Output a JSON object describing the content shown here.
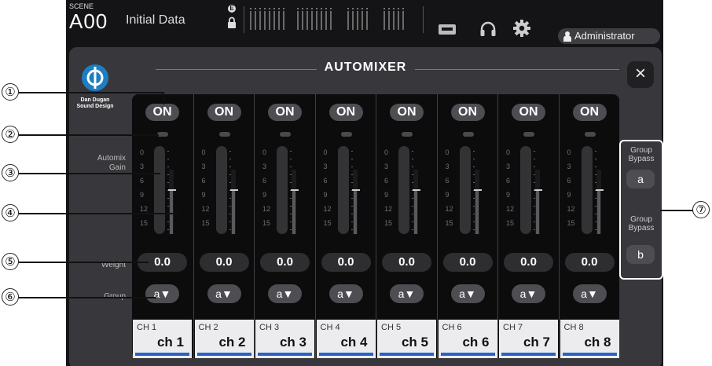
{
  "topbar": {
    "scene_label": "SCENE",
    "scene_number": "A00",
    "scene_name": "Initial Data",
    "e_badge": "E",
    "user": "Administrator"
  },
  "panel": {
    "title": "AUTOMIXER",
    "close": "×",
    "brand_line1": "Dan Dugan",
    "brand_line2": "Sound Design"
  },
  "row_labels": {
    "gain1": "Automix",
    "gain2": "Gain",
    "weight": "Weight",
    "group": "Group"
  },
  "meter_scale": [
    "0",
    "3",
    "6",
    "9",
    "12",
    "15"
  ],
  "channels": [
    {
      "on": "ON",
      "weight": "0.0",
      "group": "a▼",
      "num": "CH 1",
      "name": "ch 1"
    },
    {
      "on": "ON",
      "weight": "0.0",
      "group": "a▼",
      "num": "CH 2",
      "name": "ch 2"
    },
    {
      "on": "ON",
      "weight": "0.0",
      "group": "a▼",
      "num": "CH 3",
      "name": "ch 3"
    },
    {
      "on": "ON",
      "weight": "0.0",
      "group": "a▼",
      "num": "CH 4",
      "name": "ch 4"
    },
    {
      "on": "ON",
      "weight": "0.0",
      "group": "a▼",
      "num": "CH 5",
      "name": "ch 5"
    },
    {
      "on": "ON",
      "weight": "0.0",
      "group": "a▼",
      "num": "CH 6",
      "name": "ch 6"
    },
    {
      "on": "ON",
      "weight": "0.0",
      "group": "a▼",
      "num": "CH 7",
      "name": "ch 7"
    },
    {
      "on": "ON",
      "weight": "0.0",
      "group": "a▼",
      "num": "CH 8",
      "name": "ch 8"
    }
  ],
  "group_bypass": [
    {
      "label1": "Group",
      "label2": "Bypass",
      "button": "a"
    },
    {
      "label1": "Group",
      "label2": "Bypass",
      "button": "b"
    }
  ],
  "callouts": [
    "①",
    "②",
    "③",
    "④",
    "⑤",
    "⑥",
    "⑦"
  ],
  "colors": {
    "screen_bg": "#141416",
    "panel_bg": "#38383c",
    "channel_bar": "#2762c8",
    "logo": "#1e7ec2"
  },
  "icons": [
    "lock-icon",
    "recorder-icon",
    "headphones-icon",
    "gear-icon",
    "user-icon",
    "close-icon"
  ]
}
